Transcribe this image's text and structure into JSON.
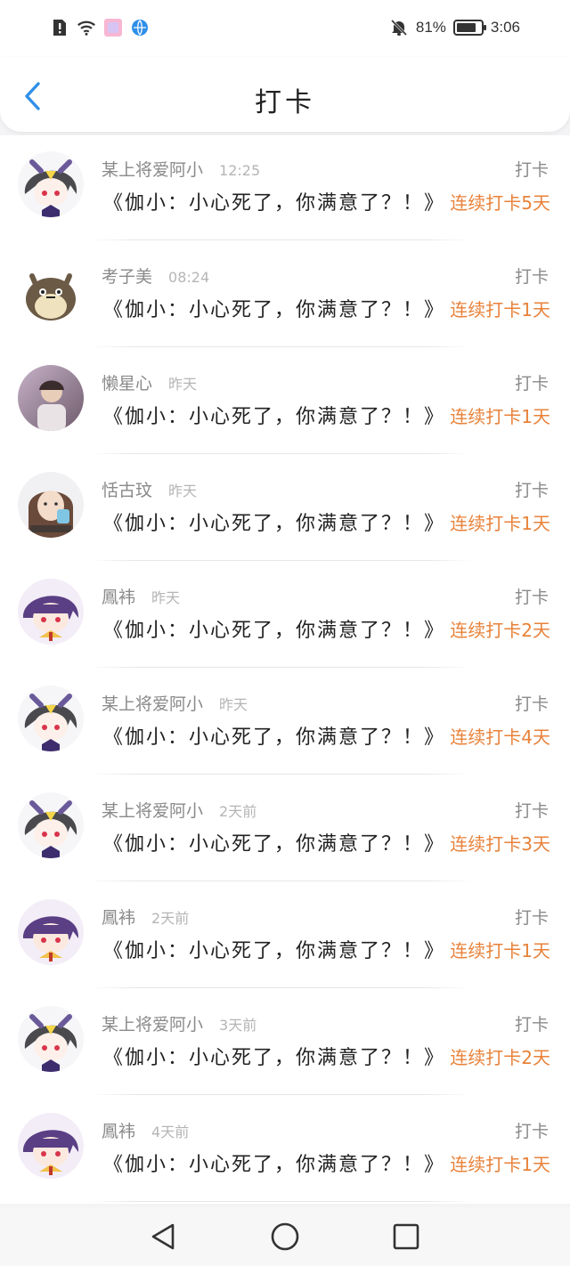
{
  "status_bar": {
    "battery_percent": "81%",
    "battery_level": 0.81,
    "time": "3:06",
    "icons_left": [
      "alert-icon",
      "wifi-icon",
      "app-icon",
      "browser-icon"
    ],
    "icons_right": [
      "mute-bell-icon",
      "battery-icon"
    ]
  },
  "header": {
    "title": "打卡",
    "back_icon": "chevron-left-icon"
  },
  "colors": {
    "accent": "#e8823a",
    "back_icon": "#2f8fe8",
    "name_gray": "#8a8a8a",
    "time_gray": "#b5b5b5"
  },
  "items": [
    {
      "name": "某上将爱阿小",
      "time": "12:25",
      "action": "打卡",
      "content": "《伽小：小心死了，你满意了？！》",
      "streak": "连续打卡5天",
      "avatar": "gray-hair-avatar"
    },
    {
      "name": "考子美",
      "time": "08:24",
      "action": "打卡",
      "content": "《伽小：小心死了，你满意了？！》",
      "streak": "连续打卡1天",
      "avatar": "totoro-avatar"
    },
    {
      "name": "懒星心",
      "time": "昨天",
      "action": "打卡",
      "content": "《伽小：小心死了，你满意了？！》",
      "streak": "连续打卡1天",
      "avatar": "photo-avatar"
    },
    {
      "name": "恬古玟",
      "time": "昨天",
      "action": "打卡",
      "content": "《伽小：小心死了，你满意了？！》",
      "streak": "连续打卡1天",
      "avatar": "girl-photo-avatar"
    },
    {
      "name": "鳳袆",
      "time": "昨天",
      "action": "打卡",
      "content": "《伽小：小心死了，你满意了？！》",
      "streak": "连续打卡2天",
      "avatar": "purple-hair-avatar"
    },
    {
      "name": "某上将爱阿小",
      "time": "昨天",
      "action": "打卡",
      "content": "《伽小：小心死了，你满意了？！》",
      "streak": "连续打卡4天",
      "avatar": "gray-hair-avatar"
    },
    {
      "name": "某上将爱阿小",
      "time": "2天前",
      "action": "打卡",
      "content": "《伽小：小心死了，你满意了？！》",
      "streak": "连续打卡3天",
      "avatar": "gray-hair-avatar"
    },
    {
      "name": "鳳袆",
      "time": "2天前",
      "action": "打卡",
      "content": "《伽小：小心死了，你满意了？！》",
      "streak": "连续打卡1天",
      "avatar": "purple-hair-avatar"
    },
    {
      "name": "某上将爱阿小",
      "time": "3天前",
      "action": "打卡",
      "content": "《伽小：小心死了，你满意了？！》",
      "streak": "连续打卡2天",
      "avatar": "gray-hair-avatar"
    },
    {
      "name": "鳳袆",
      "time": "4天前",
      "action": "打卡",
      "content": "《伽小：小心死了，你满意了？！》",
      "streak": "连续打卡1天",
      "avatar": "purple-hair-avatar"
    }
  ],
  "nav_bar": {
    "buttons": [
      "back-triangle-icon",
      "home-circle-icon",
      "recent-square-icon"
    ]
  }
}
